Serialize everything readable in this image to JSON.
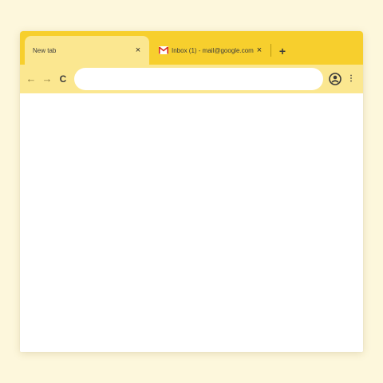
{
  "tabs": [
    {
      "title": "New tab",
      "close": "×",
      "active": true
    },
    {
      "title": "Inbox (1) - mail@google.com",
      "close": "×",
      "active": false,
      "favicon": "gmail-icon"
    }
  ],
  "newtab": "+",
  "nav": {
    "back": "←",
    "forward": "→",
    "reload": "C"
  },
  "omnibox": {
    "value": ""
  },
  "menu": "⋮",
  "colors": {
    "tabstrip": "#f7cf2d",
    "toolbar": "#fbe790",
    "page_background": "#fdf7dc"
  },
  "icons": [
    "arrow-back-icon",
    "arrow-forward-icon",
    "reload-icon",
    "profile-icon",
    "menu-icon",
    "gmail-icon"
  ]
}
